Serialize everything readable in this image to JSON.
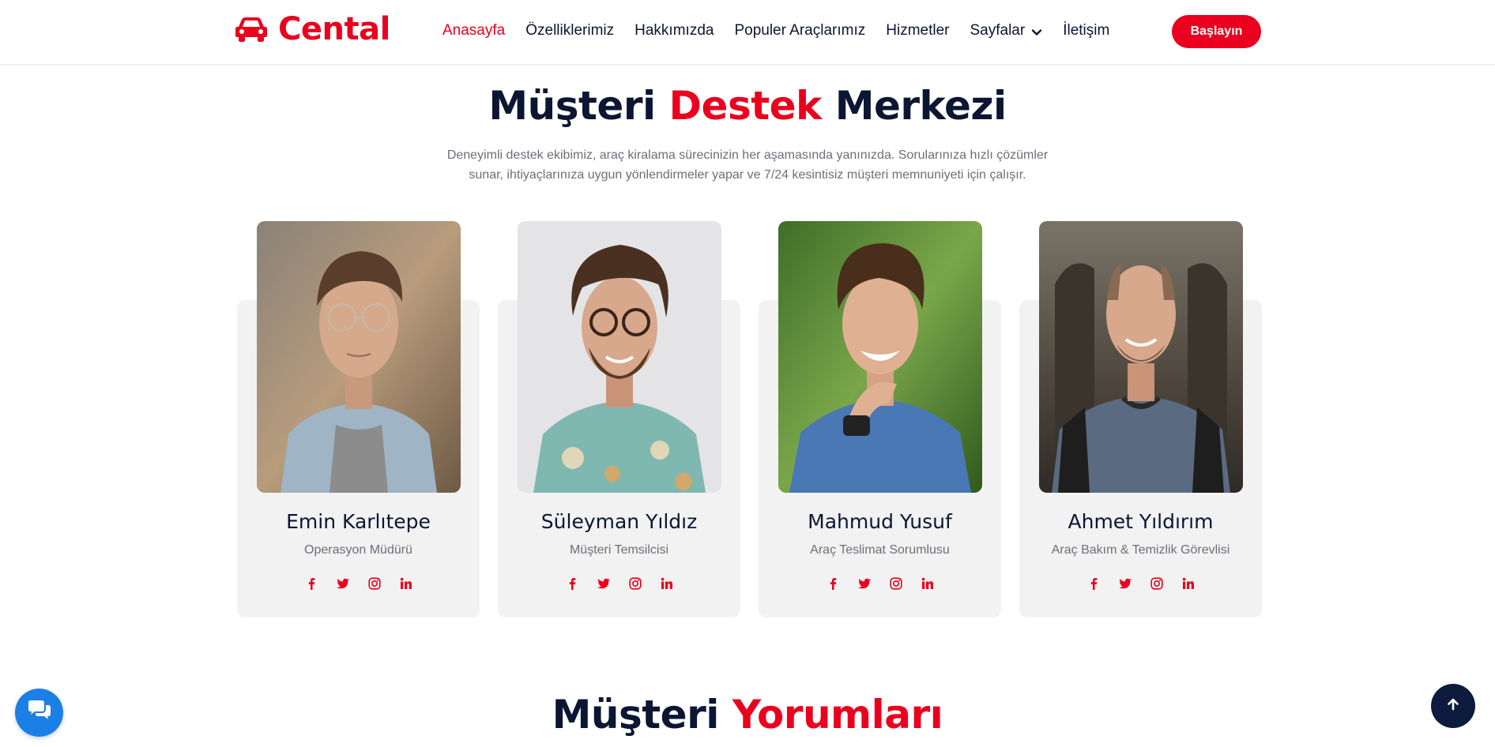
{
  "brand": {
    "name": "Cental",
    "icon": "car-icon",
    "color": "#ea001e"
  },
  "nav": {
    "items": [
      {
        "label": "Anasayfa",
        "active": true
      },
      {
        "label": "Özelliklerimiz"
      },
      {
        "label": "Hakkımızda"
      },
      {
        "label": "Populer Araçlarımız"
      },
      {
        "label": "Hizmetler"
      },
      {
        "label": "Sayfalar",
        "dropdown": true
      },
      {
        "label": "İletişim"
      }
    ],
    "cta_label": "Başlayın"
  },
  "section": {
    "title_part1": "Müşteri",
    "title_accent": "Destek",
    "title_part2": "Merkezi",
    "description": "Deneyimli destek ekibimiz, araç kiralama sürecinizin her aşamasında yanınızda. Sorularınıza hızlı çözümler sunar, ihtiyaçlarınıza uygun yönlendirmeler yapar ve 7/24 kesintisiz müşteri memnuniyeti için çalışır."
  },
  "team": [
    {
      "name": "Emin Karlıtepe",
      "role": "Operasyon Müdürü"
    },
    {
      "name": "Süleyman Yıldız",
      "role": "Müşteri Temsilcisi"
    },
    {
      "name": "Mahmud Yusuf",
      "role": "Araç Teslimat Sorumlusu"
    },
    {
      "name": "Ahmet Yıldırım",
      "role": "Araç Bakım & Temizlik Görevlisi"
    }
  ],
  "socials": [
    "facebook-icon",
    "twitter-icon",
    "instagram-icon",
    "linkedin-icon"
  ],
  "next_section": {
    "title_part1": "Müşteri",
    "title_accent": "Yorumları"
  },
  "colors": {
    "accent": "#ea001e",
    "dark": "#0b1633",
    "muted": "#6b6f7a",
    "card_bg": "#f2f2f2",
    "chat": "#1c7fe6",
    "top_btn": "#0d1b3e"
  }
}
